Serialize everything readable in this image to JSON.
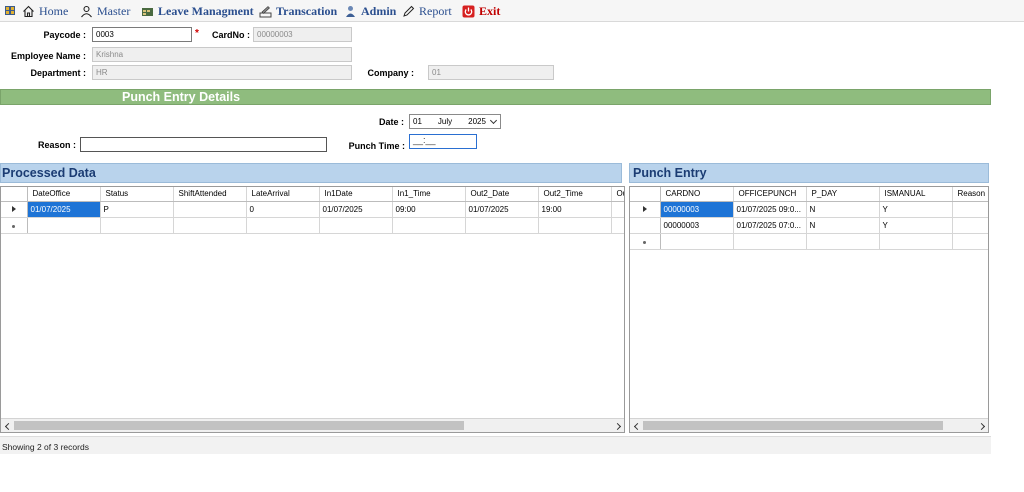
{
  "menu": {
    "items": [
      {
        "label": "Home",
        "icon": "home-icon"
      },
      {
        "label": "Master",
        "icon": "person-icon"
      },
      {
        "label": "Leave Managment",
        "icon": "calendar-icon"
      },
      {
        "label": "Transcation",
        "icon": "pencil-note-icon"
      },
      {
        "label": "Admin",
        "icon": "admin-person-icon"
      },
      {
        "label": "Report",
        "icon": "pen-icon"
      },
      {
        "label": "Exit",
        "icon": "power-icon"
      }
    ]
  },
  "form": {
    "paycode_label": "Paycode :",
    "paycode_value": "0003",
    "required_mark": "*",
    "cardno_label": "CardNo :",
    "cardno_value": "00000003",
    "employee_name_label": "Employee Name :",
    "employee_name_value": "Krishna",
    "department_label": "Department :",
    "department_value": "HR",
    "company_label": "Company :",
    "company_value": "01"
  },
  "punch_section": {
    "title": "Punch Entry Details",
    "date_label": "Date :",
    "date_day": "01",
    "date_month": "July",
    "date_year": "2025",
    "reason_label": "Reason :",
    "reason_value": "",
    "punch_time_label": "Punch Time :",
    "punch_time_value": "__:__"
  },
  "processed": {
    "title": "Processed Data",
    "columns": [
      "DateOffice",
      "Status",
      "ShiftAttended",
      "LateArrival",
      "In1Date",
      "In1_Time",
      "Out2_Date",
      "Out2_Time",
      "Ou"
    ],
    "rows": [
      [
        "01/07/2025",
        "P",
        "",
        "0",
        "01/07/2025",
        "09:00",
        "01/07/2025",
        "19:00",
        ""
      ]
    ]
  },
  "punch_entry": {
    "title": "Punch Entry",
    "columns": [
      "CARDNO",
      "OFFICEPUNCH",
      "P_DAY",
      "ISMANUAL",
      "Reason"
    ],
    "rows": [
      [
        "00000003",
        "01/07/2025 09:0...",
        "N",
        "Y",
        ""
      ],
      [
        "00000003",
        "01/07/2025 07:0...",
        "N",
        "Y",
        ""
      ]
    ]
  },
  "status": {
    "text": "Showing 2 of 3 records"
  },
  "colors": {
    "section_band": "#8fbc7e",
    "panel_header": "#b9d3ec",
    "selection": "#1e74d6",
    "menu_text": "#2b4f8f",
    "exit_text": "#c00000"
  }
}
